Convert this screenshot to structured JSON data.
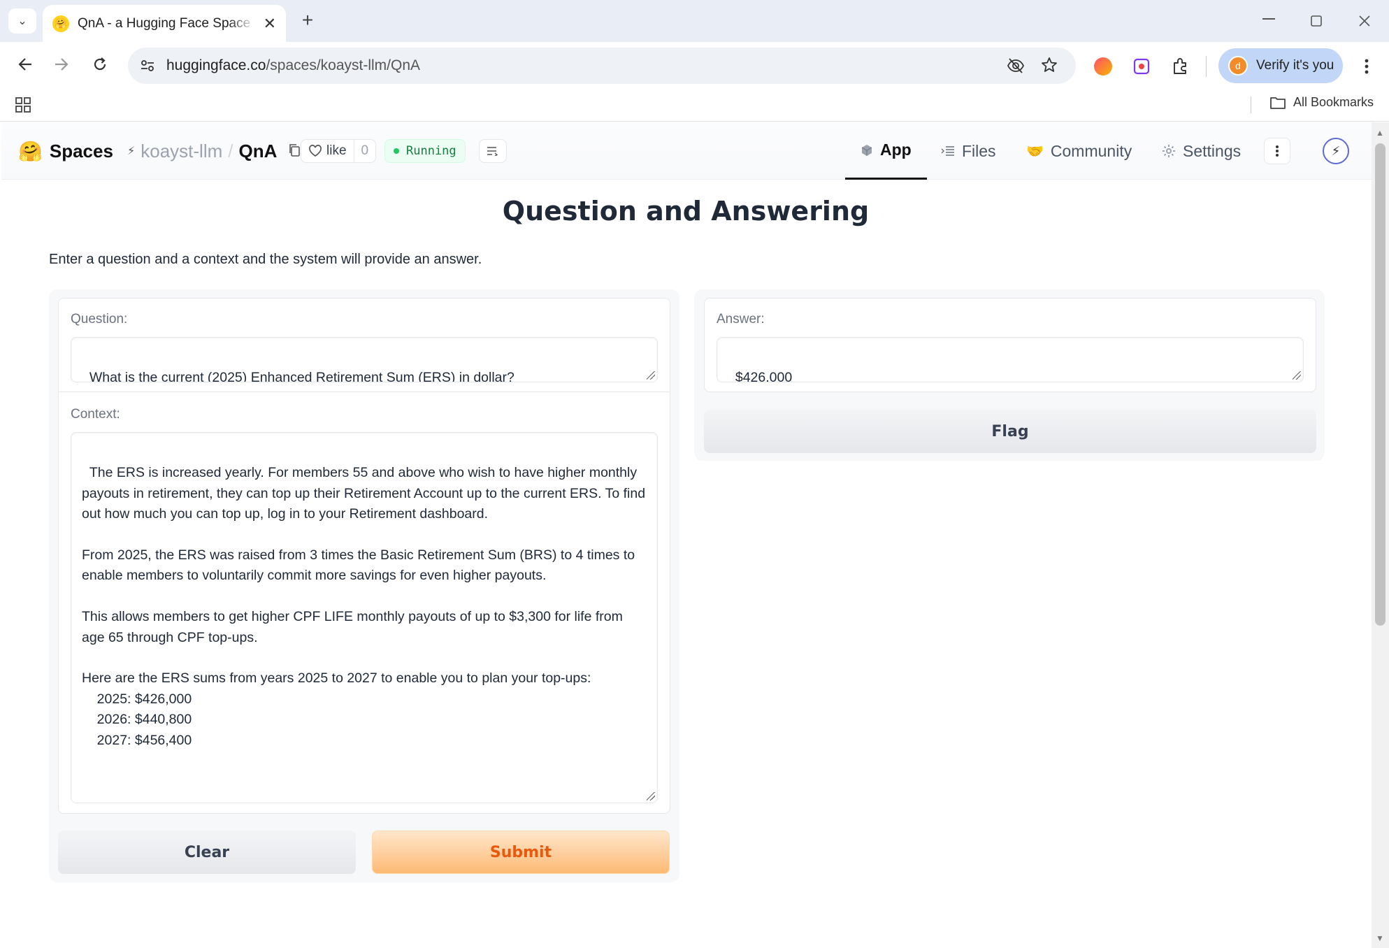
{
  "browser": {
    "tab_title": "QnA - a Hugging Face Space by koayst-llm",
    "tab_close": "✕",
    "new_tab": "+",
    "url_host": "huggingface.co",
    "url_path": "/spaces/koayst-llm/QnA",
    "verify_label": "Verify it's you",
    "verify_avatar_letter": "d",
    "all_bookmarks": "All Bookmarks"
  },
  "hf_header": {
    "spaces_label": "Spaces",
    "owner": "koayst-llm",
    "separator": "/",
    "repo": "QnA",
    "like_label": "like",
    "like_count": "0",
    "status": "Running",
    "tabs": [
      {
        "label": "App",
        "icon": "cube-icon",
        "active": true
      },
      {
        "label": "Files",
        "icon": "files-icon"
      },
      {
        "label": "Community",
        "icon": "hf-community-icon"
      },
      {
        "label": "Settings",
        "icon": "gear-icon"
      }
    ]
  },
  "main": {
    "title": "Question and Answering",
    "description": "Enter a question and a context and the system will provide an answer.",
    "question_label": "Question:",
    "question_value": "What is the current (2025) Enhanced Retirement Sum (ERS) in dollar?",
    "context_label": "Context:",
    "context_value": "The ERS is increased yearly. For members 55 and above who wish to have higher monthly payouts in retirement, they can top up their Retirement Account up to the current ERS. To find out how much you can top up, log in to your Retirement dashboard.\n\nFrom 2025, the ERS was raised from 3 times the Basic Retirement Sum (BRS) to 4 times to enable members to voluntarily commit more savings for even higher payouts.\n\nThis allows members to get higher CPF LIFE monthly payouts of up to $3,300 for life from age 65 through CPF top-ups.\n\nHere are the ERS sums from years 2025 to 2027 to enable you to plan your top-ups:\n    2025: $426,000\n    2026: $440,800\n    2027: $456,400",
    "answer_label": "Answer:",
    "answer_value": "$426,000",
    "clear_label": "Clear",
    "submit_label": "Submit",
    "flag_label": "Flag"
  }
}
